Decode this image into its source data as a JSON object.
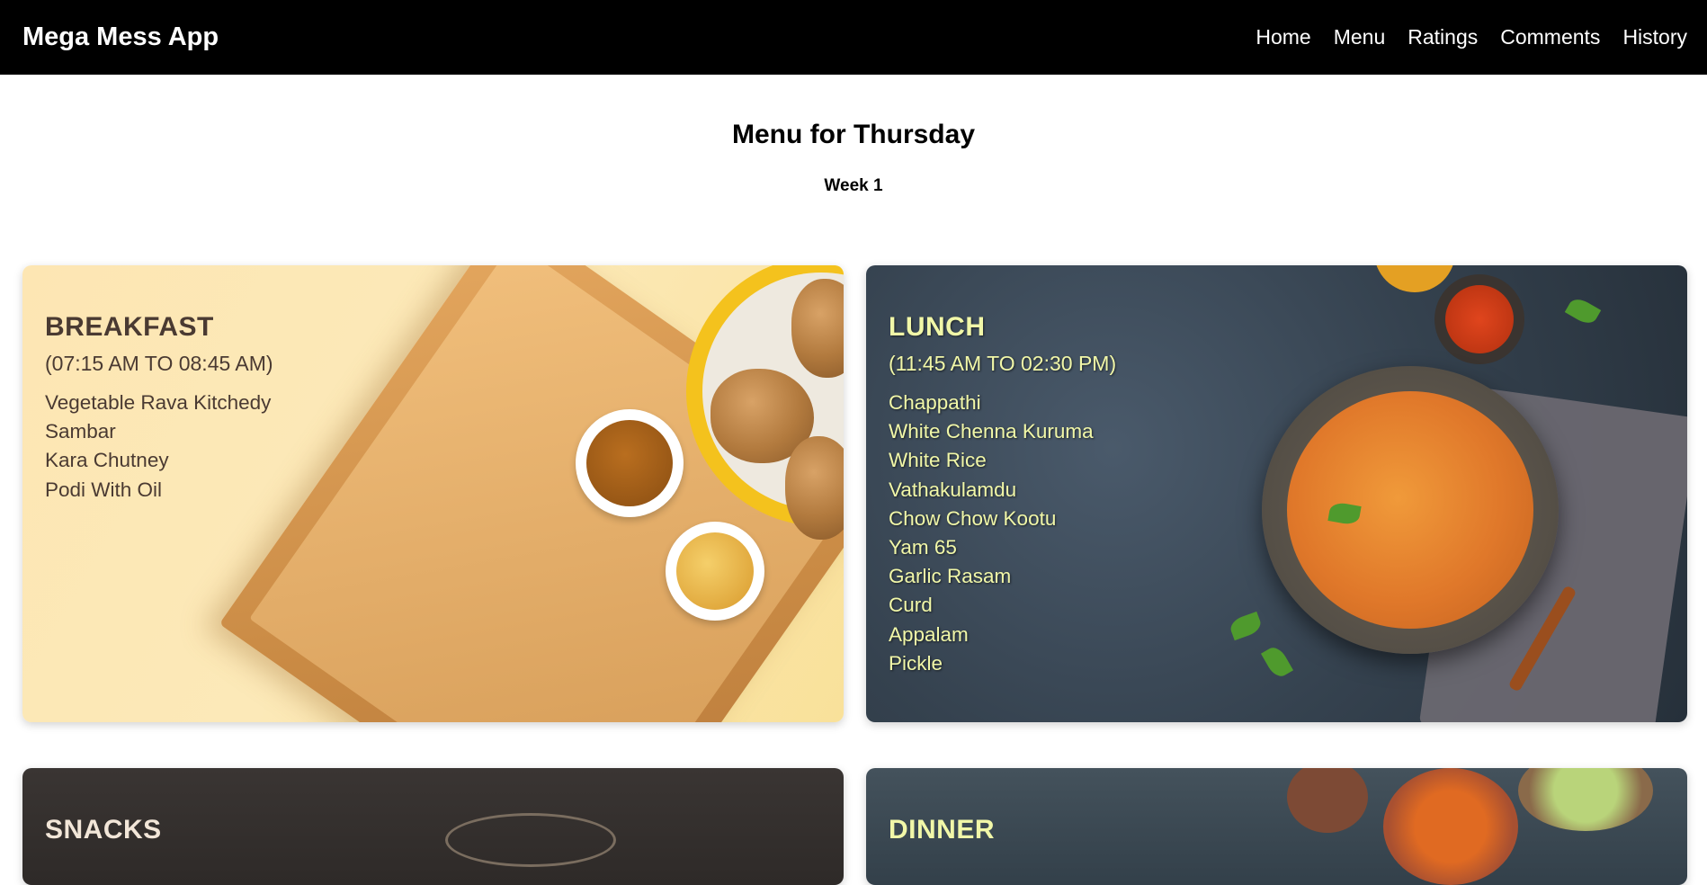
{
  "app": {
    "brand": "Mega Mess App"
  },
  "nav": {
    "items": [
      {
        "label": "Home"
      },
      {
        "label": "Menu"
      },
      {
        "label": "Ratings"
      },
      {
        "label": "Comments"
      },
      {
        "label": "History"
      }
    ]
  },
  "page": {
    "title": "Menu for Thursday",
    "week": "Week 1"
  },
  "meals": {
    "breakfast": {
      "title": "BREAKFAST",
      "time": "(07:15 AM TO 08:45 AM)",
      "items": [
        "Vegetable Rava Kitchedy",
        "Sambar",
        "Kara Chutney",
        "Podi With Oil"
      ]
    },
    "lunch": {
      "title": "LUNCH",
      "time": "(11:45 AM TO 02:30 PM)",
      "items": [
        "Chappathi",
        "White Chenna Kuruma",
        "White Rice",
        "Vathakulamdu",
        "Chow Chow Kootu",
        "Yam 65",
        "Garlic Rasam",
        "Curd",
        "Appalam",
        "Pickle"
      ]
    },
    "snacks": {
      "title": "SNACKS"
    },
    "dinner": {
      "title": "DINNER"
    }
  }
}
